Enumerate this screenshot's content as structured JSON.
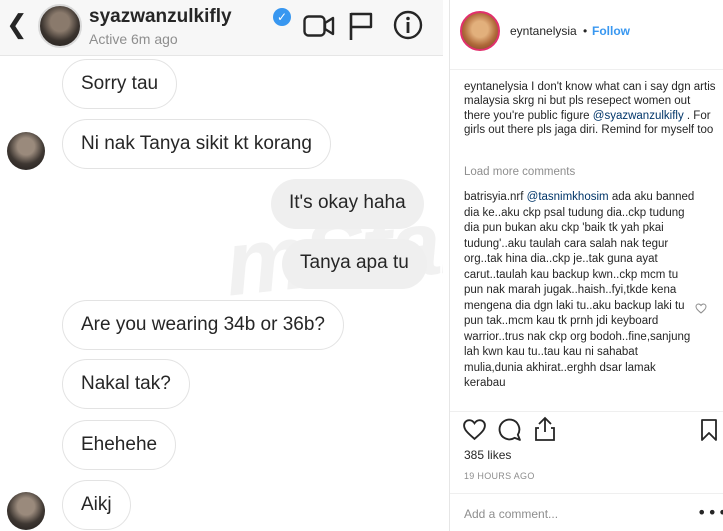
{
  "dm": {
    "back_glyph": "❮",
    "username": "syazwanzulkifly",
    "verified_glyph": "✓",
    "status": "Active 6m ago",
    "icons": [
      "video-call-icon",
      "flag-icon",
      "info-icon"
    ],
    "messages": [
      {
        "side": "in",
        "text": "Sorry tau"
      },
      {
        "side": "in",
        "text": "Ni nak Tanya sikit kt korang"
      },
      {
        "side": "out",
        "text": "It's okay haha"
      },
      {
        "side": "out",
        "text": "Tanya apa tu"
      },
      {
        "side": "in",
        "text": "Are you wearing 34b or 36b?"
      },
      {
        "side": "in",
        "text": "Nakal tak?"
      },
      {
        "side": "in",
        "text": "Ehehehe"
      },
      {
        "side": "in",
        "text": "Aikj"
      }
    ],
    "watermark": "mStar"
  },
  "post": {
    "username": "eyntanelysia",
    "dot": "•",
    "follow": "Follow",
    "caption": {
      "username": "eyntanelysia",
      "text_before": " I don't know what can i say dgn artis malaysia skrg ni but pls resepect women out there you're public figure ",
      "mention": "@syazwanzulkifly",
      "text_after": " . For girls out there pls jaga diri. Remind for myself too"
    },
    "load_more": "Load more comments",
    "comment": {
      "username": "batrisyia.nrf",
      "mention": "@tasnimkhosim",
      "text": " ada aku banned dia ke..aku ckp psal tudung dia..ckp tudung dia pun bukan aku ckp 'baik tk yah pkai tudung'..aku taulah cara salah nak tegur org..tak hina dia..ckp je..tak guna ayat carut..taulah kau backup kwn..ckp mcm tu pun nak marah jugak..haish..fyi,tkde kena mengena dia dgn laki tu..aku backup laki tu pun tak..mcm kau tk prnh jdi keyboard warrior..trus nak ckp org bodoh..fine,sanjung lah kwn kau tu..tau kau ni sahabat mulia,dunia akhirat..erghh dsar lamak kerabau"
    },
    "likes": "385 likes",
    "timestamp": "19 HOURS AGO",
    "add_comment_placeholder": "Add a comment...",
    "more": "•••"
  }
}
